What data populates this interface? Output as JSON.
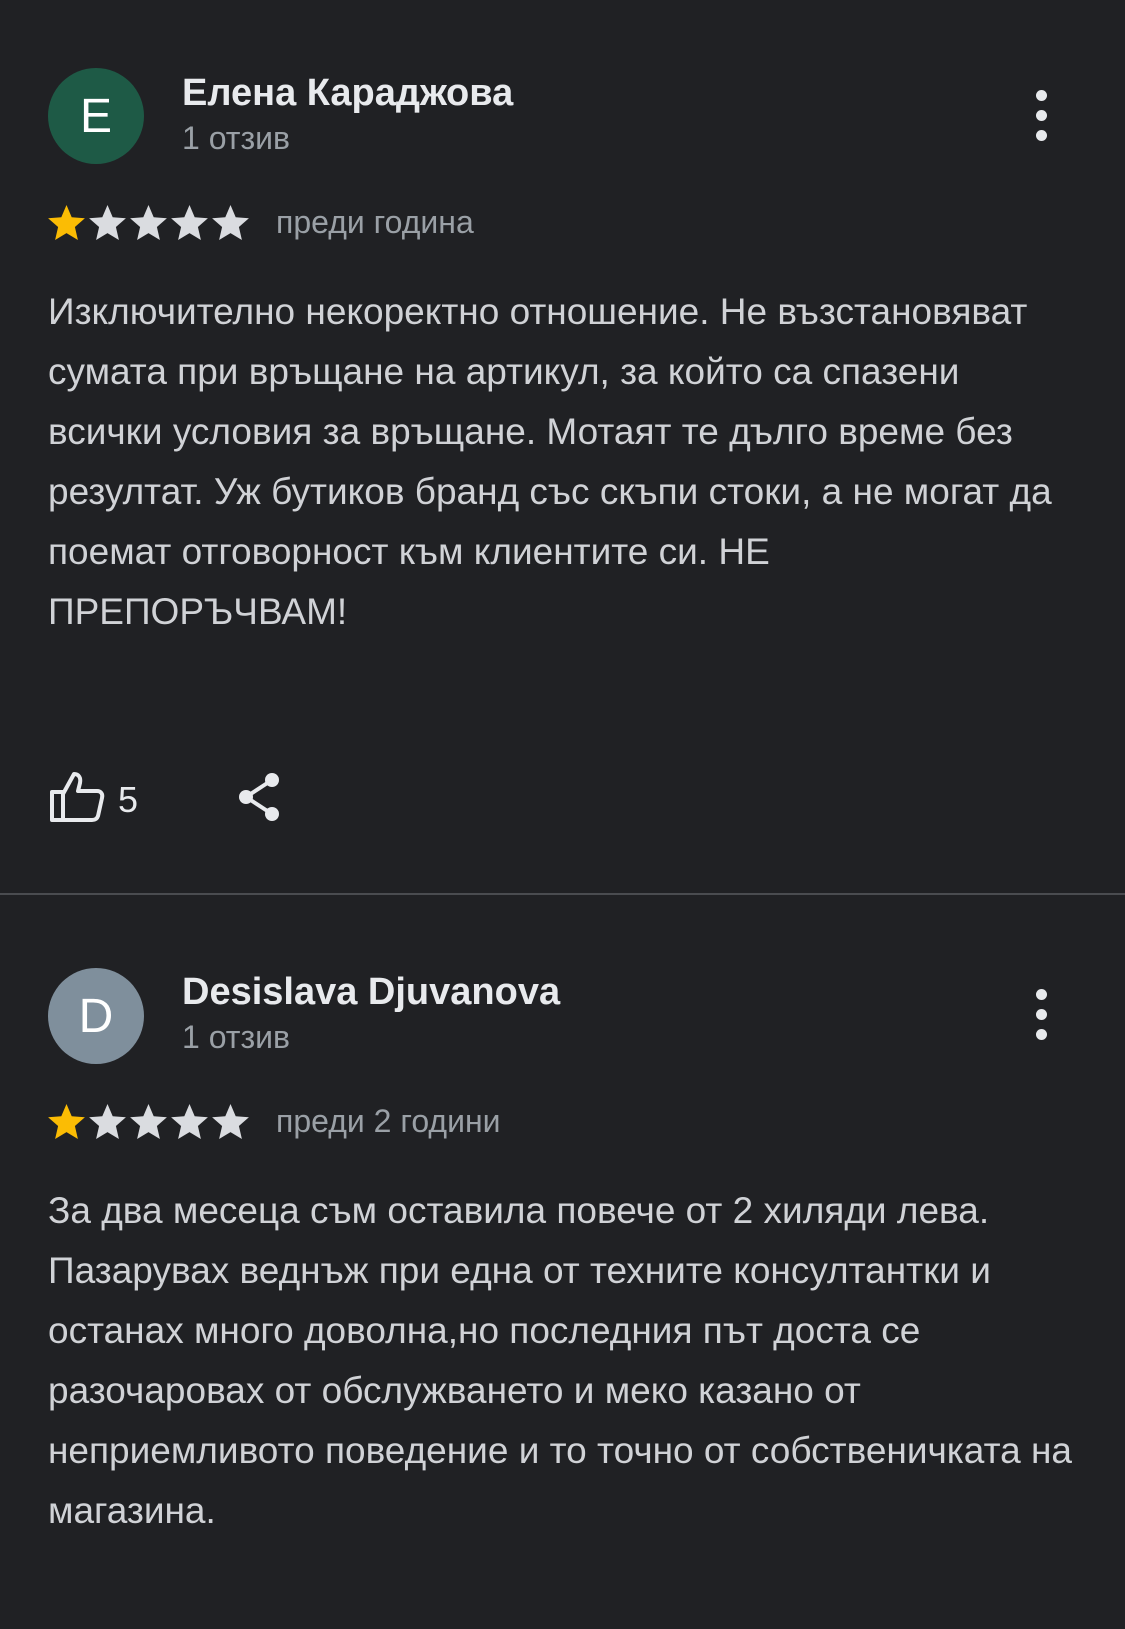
{
  "reviews": [
    {
      "avatar_letter": "E",
      "avatar_color": "#1e5a46",
      "author": "Елена Караджова",
      "review_count": "1 отзив",
      "rating": 1,
      "max_rating": 5,
      "date": "преди година",
      "text": "Изключително некоректно отношение. Не възстановяват сумата при връщане на артикул, за който са спазени всички условия за връщане. Мотаят те дълго време без резултат. Уж бутиков бранд със скъпи стоки, а не могат да поемат отговорност към клиентите си. НЕ ПРЕПОРЪЧВАМ!",
      "likes": "5",
      "icons": {
        "like": "thumbs-up-icon",
        "share": "share-icon",
        "more": "more-vert-icon"
      }
    },
    {
      "avatar_letter": "D",
      "avatar_color": "#7f8f9c",
      "author": "Desislava Djuvanova",
      "review_count": "1 отзив",
      "rating": 1,
      "max_rating": 5,
      "date": "преди 2 години",
      "text": "За два месеца съм оставила повече от 2 хиляди лева. Пазарувах веднъж при една от техните консултантки и останах много доволна,но последния път доста се разочаровах от обслужването и меко казано от неприемливото поведение и то точно от собственичката на магазина.",
      "icons": {
        "more": "more-vert-icon"
      }
    }
  ],
  "colors": {
    "background": "#202124",
    "star_filled": "#fbbc04",
    "star_empty": "#dadce0",
    "secondary_text": "#9aa0a6"
  }
}
